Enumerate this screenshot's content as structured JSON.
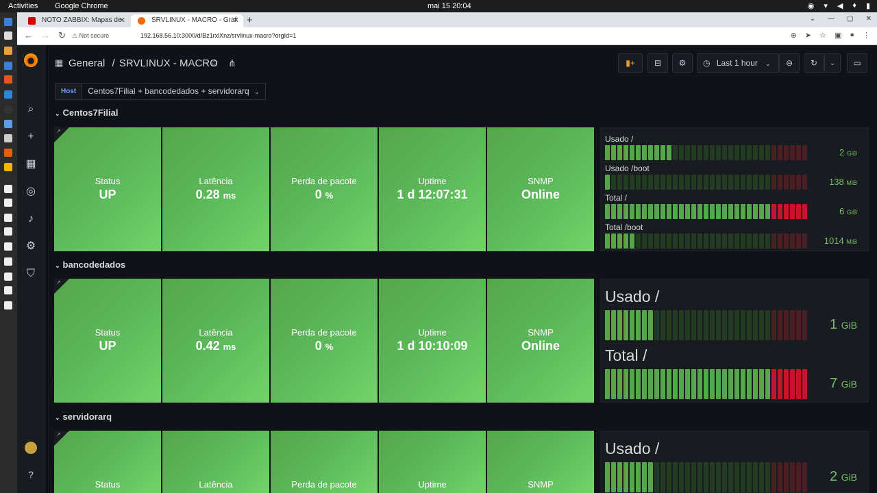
{
  "os": {
    "activities": "Activities",
    "app": "Google Chrome",
    "clock": "mai 15  20:04"
  },
  "browser": {
    "tabs": [
      {
        "title": "NOTO ZABBIX: Mapas de",
        "favicon_color": "#d40000"
      },
      {
        "title": "SRVLINUX - MACRO - Graf",
        "favicon_color": "#f46800"
      }
    ],
    "not_secure": "Not secure",
    "url": "192.168.56.10:3000/d/Bz1rxlXnz/srvlinux-macro?orgId=1"
  },
  "header": {
    "section": "General",
    "separator": "/",
    "title": "SRVLINUX - MACRO",
    "time_range": "Last 1 hour"
  },
  "variable": {
    "label": "Host",
    "value": "Centos7Filial + bancodedados + servidorarq"
  },
  "colors": {
    "stat_green": "#56a64b",
    "gauge_value": "#73bf69",
    "bar_on": "#56a64b",
    "bar_off": "#233b22",
    "bar_red_off": "#4a1f24"
  },
  "rows": [
    {
      "name": "Centos7Filial",
      "stats": [
        {
          "title": "Status",
          "value": "UP",
          "unit": ""
        },
        {
          "title": "Latência",
          "value": "0.28",
          "unit": "ms"
        },
        {
          "title": "Perda de pacote",
          "value": "0",
          "unit": "%"
        },
        {
          "title": "Uptime",
          "value": "1 d 12:07:31",
          "unit": ""
        },
        {
          "title": "SNMP",
          "value": "Online",
          "unit": ""
        }
      ],
      "gauges": [
        {
          "label": "Usado /",
          "value": "2",
          "unit": "GiB",
          "fill": 0.33
        },
        {
          "label": "Usado /boot",
          "value": "138",
          "unit": "MiB",
          "fill": 0.03
        },
        {
          "label": "Total /",
          "value": "6",
          "unit": "GiB",
          "fill": 1.0
        },
        {
          "label": "Total /boot",
          "value": "1014",
          "unit": "MiB",
          "fill": 0.16
        }
      ]
    },
    {
      "name": "bancodedados",
      "stats": [
        {
          "title": "Status",
          "value": "UP",
          "unit": ""
        },
        {
          "title": "Latência",
          "value": "0.42",
          "unit": "ms"
        },
        {
          "title": "Perda de pacote",
          "value": "0",
          "unit": "%"
        },
        {
          "title": "Uptime",
          "value": "1 d 10:10:09",
          "unit": ""
        },
        {
          "title": "SNMP",
          "value": "Online",
          "unit": ""
        }
      ],
      "gauges": [
        {
          "label": "Usado /",
          "value": "1",
          "unit": "GiB",
          "fill": 0.23
        },
        {
          "label": "Total /",
          "value": "7",
          "unit": "GiB",
          "fill": 1.0
        }
      ]
    },
    {
      "name": "servidorarq",
      "stats": [
        {
          "title": "Status",
          "value": "",
          "unit": ""
        },
        {
          "title": "Latência",
          "value": "",
          "unit": ""
        },
        {
          "title": "Perda de pacote",
          "value": "",
          "unit": ""
        },
        {
          "title": "Uptime",
          "value": "",
          "unit": ""
        },
        {
          "title": "SNMP",
          "value": "",
          "unit": ""
        }
      ],
      "gauges": [
        {
          "label": "Usado /",
          "value": "2",
          "unit": "GiB",
          "fill": 0.23
        }
      ]
    }
  ]
}
